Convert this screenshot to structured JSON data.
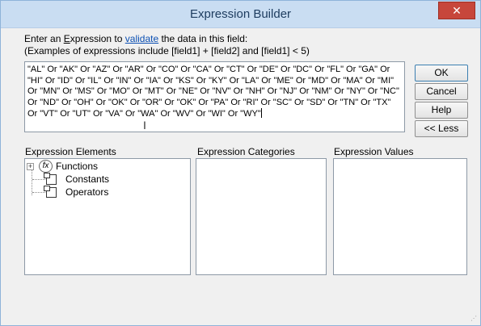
{
  "window": {
    "title": "Expression Builder",
    "close_label": "✕"
  },
  "prompt": {
    "line1_pre": "Enter an ",
    "line1_u": "E",
    "line1_mid": "xpression to ",
    "line1_link": "validate",
    "line1_post": " the data in this field:",
    "line2": "(Examples of expressions include [field1] + [field2] and [field1] < 5)"
  },
  "expression": {
    "value": "\"AL\" Or \"AK\" Or \"AZ\" Or \"AR\" Or \"CO\" Or \"CA\" Or \"CT\" Or \"DE\" Or \"DC\" Or \"FL\" Or \"GA\" Or \"HI\" Or \"ID\" Or \"IL\" Or \"IN\" Or \"IA\" Or \"KS\" Or \"KY\" Or \"LA\" Or \"ME\" Or \"MD\" Or \"MA\" Or \"MI\" Or \"MN\" Or \"MS\" Or \"MO\" Or \"MT\" Or \"NE\" Or \"NV\" Or \"NH\" Or \"NJ\" Or \"NM\" Or \"NY\" Or \"NC\" Or \"ND\" Or \"OH\" Or \"OK\" Or \"OR\" Or \"OK\" Or \"PA\" Or \"RI\" Or \"SC\" Or \"SD\" Or \"TN\" Or \"TX\" Or \"VT\" Or \"UT\" Or \"VA\" Or \"WA\" Or \"WV\" Or \"WI\" Or \"WY\""
  },
  "buttons": {
    "ok": "OK",
    "cancel": "Cancel",
    "help": "Help",
    "less": "<< Less"
  },
  "sections": {
    "elements": "Expression Elements",
    "categories": "Expression Categories",
    "values": "Expression Values"
  },
  "tree": [
    {
      "label": "Functions",
      "icon": "function-icon",
      "expander": "+"
    },
    {
      "label": "Constants",
      "icon": "folder-icon"
    },
    {
      "label": "Operators",
      "icon": "folder-icon"
    }
  ],
  "colors": {
    "accent": "#c9ddf2",
    "close": "#c7463b",
    "link": "#0b4fb3"
  }
}
